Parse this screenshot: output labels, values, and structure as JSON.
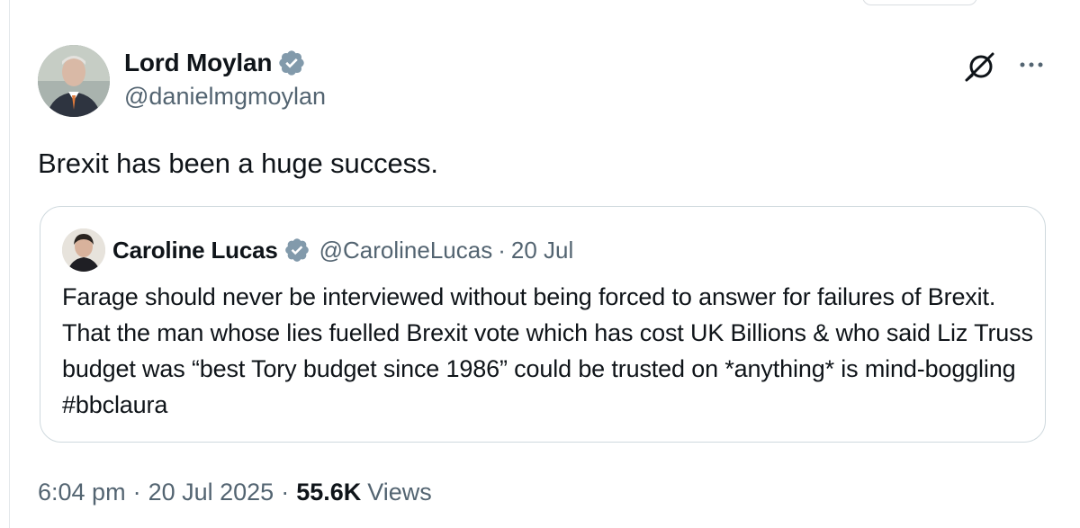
{
  "tweet": {
    "author": {
      "name": "Lord Moylan",
      "handle": "@danielmgmoylan",
      "verified": true,
      "verified_color": "#829aab"
    },
    "text": "Brexit has been a huge success.",
    "quoted": {
      "author": {
        "name": "Caroline Lucas",
        "handle": "@CarolineLucas",
        "verified": true
      },
      "separator": "·",
      "date": "20 Jul",
      "text": "Farage should never be interviewed without being forced to answer for failures of Brexit. That the man whose lies fuelled Brexit vote which has cost UK Billions & who said Liz Truss budget was “best Tory budget since 1986” could be trusted on *anything* is mind-boggling #bbclaura"
    },
    "meta": {
      "time": "6:04 pm",
      "separator": "·",
      "date": "20 Jul 2025",
      "views_count": "55.6K",
      "views_label": "Views"
    },
    "icons": {
      "grok": "grok-icon",
      "more": "more-icon"
    }
  },
  "colors": {
    "text_primary": "#0f1419",
    "text_secondary": "#536471",
    "border": "#cfd9de"
  }
}
